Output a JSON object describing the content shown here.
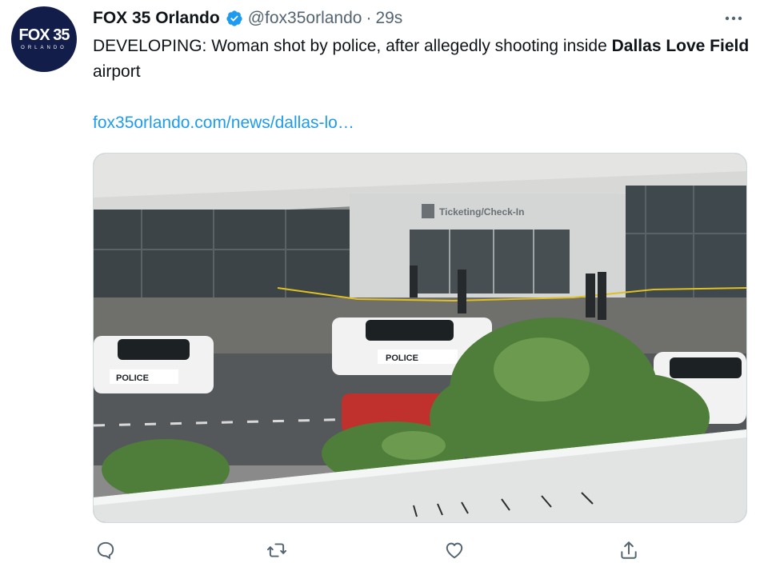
{
  "account": {
    "display_name": "FOX 35 Orlando",
    "handle": "@fox35orlando",
    "separator": "·",
    "time": "29s",
    "avatar_logo_main": "FOX 35",
    "avatar_logo_sub": "ORLANDO"
  },
  "tweet": {
    "text_part1": "DEVELOPING: Woman shot by police, after allegedly shooting inside ",
    "text_bold": "Dallas Love Field",
    "text_part2": " airport",
    "link": "fox35orlando.com/news/dallas-lo…"
  },
  "media": {
    "building_sign": "Ticketing/Check-In",
    "car_label": "POLICE"
  },
  "icons": {
    "verified": "verified-badge-icon",
    "more": "more-options-icon",
    "reply": "reply-icon",
    "retweet": "retweet-icon",
    "like": "like-icon",
    "share": "share-icon"
  },
  "colors": {
    "link": "#1d9bf0",
    "verified": "#1d9bf0",
    "avatar_bg": "#131d4a",
    "secondary_text": "#536471",
    "action_icon": "#536471"
  }
}
